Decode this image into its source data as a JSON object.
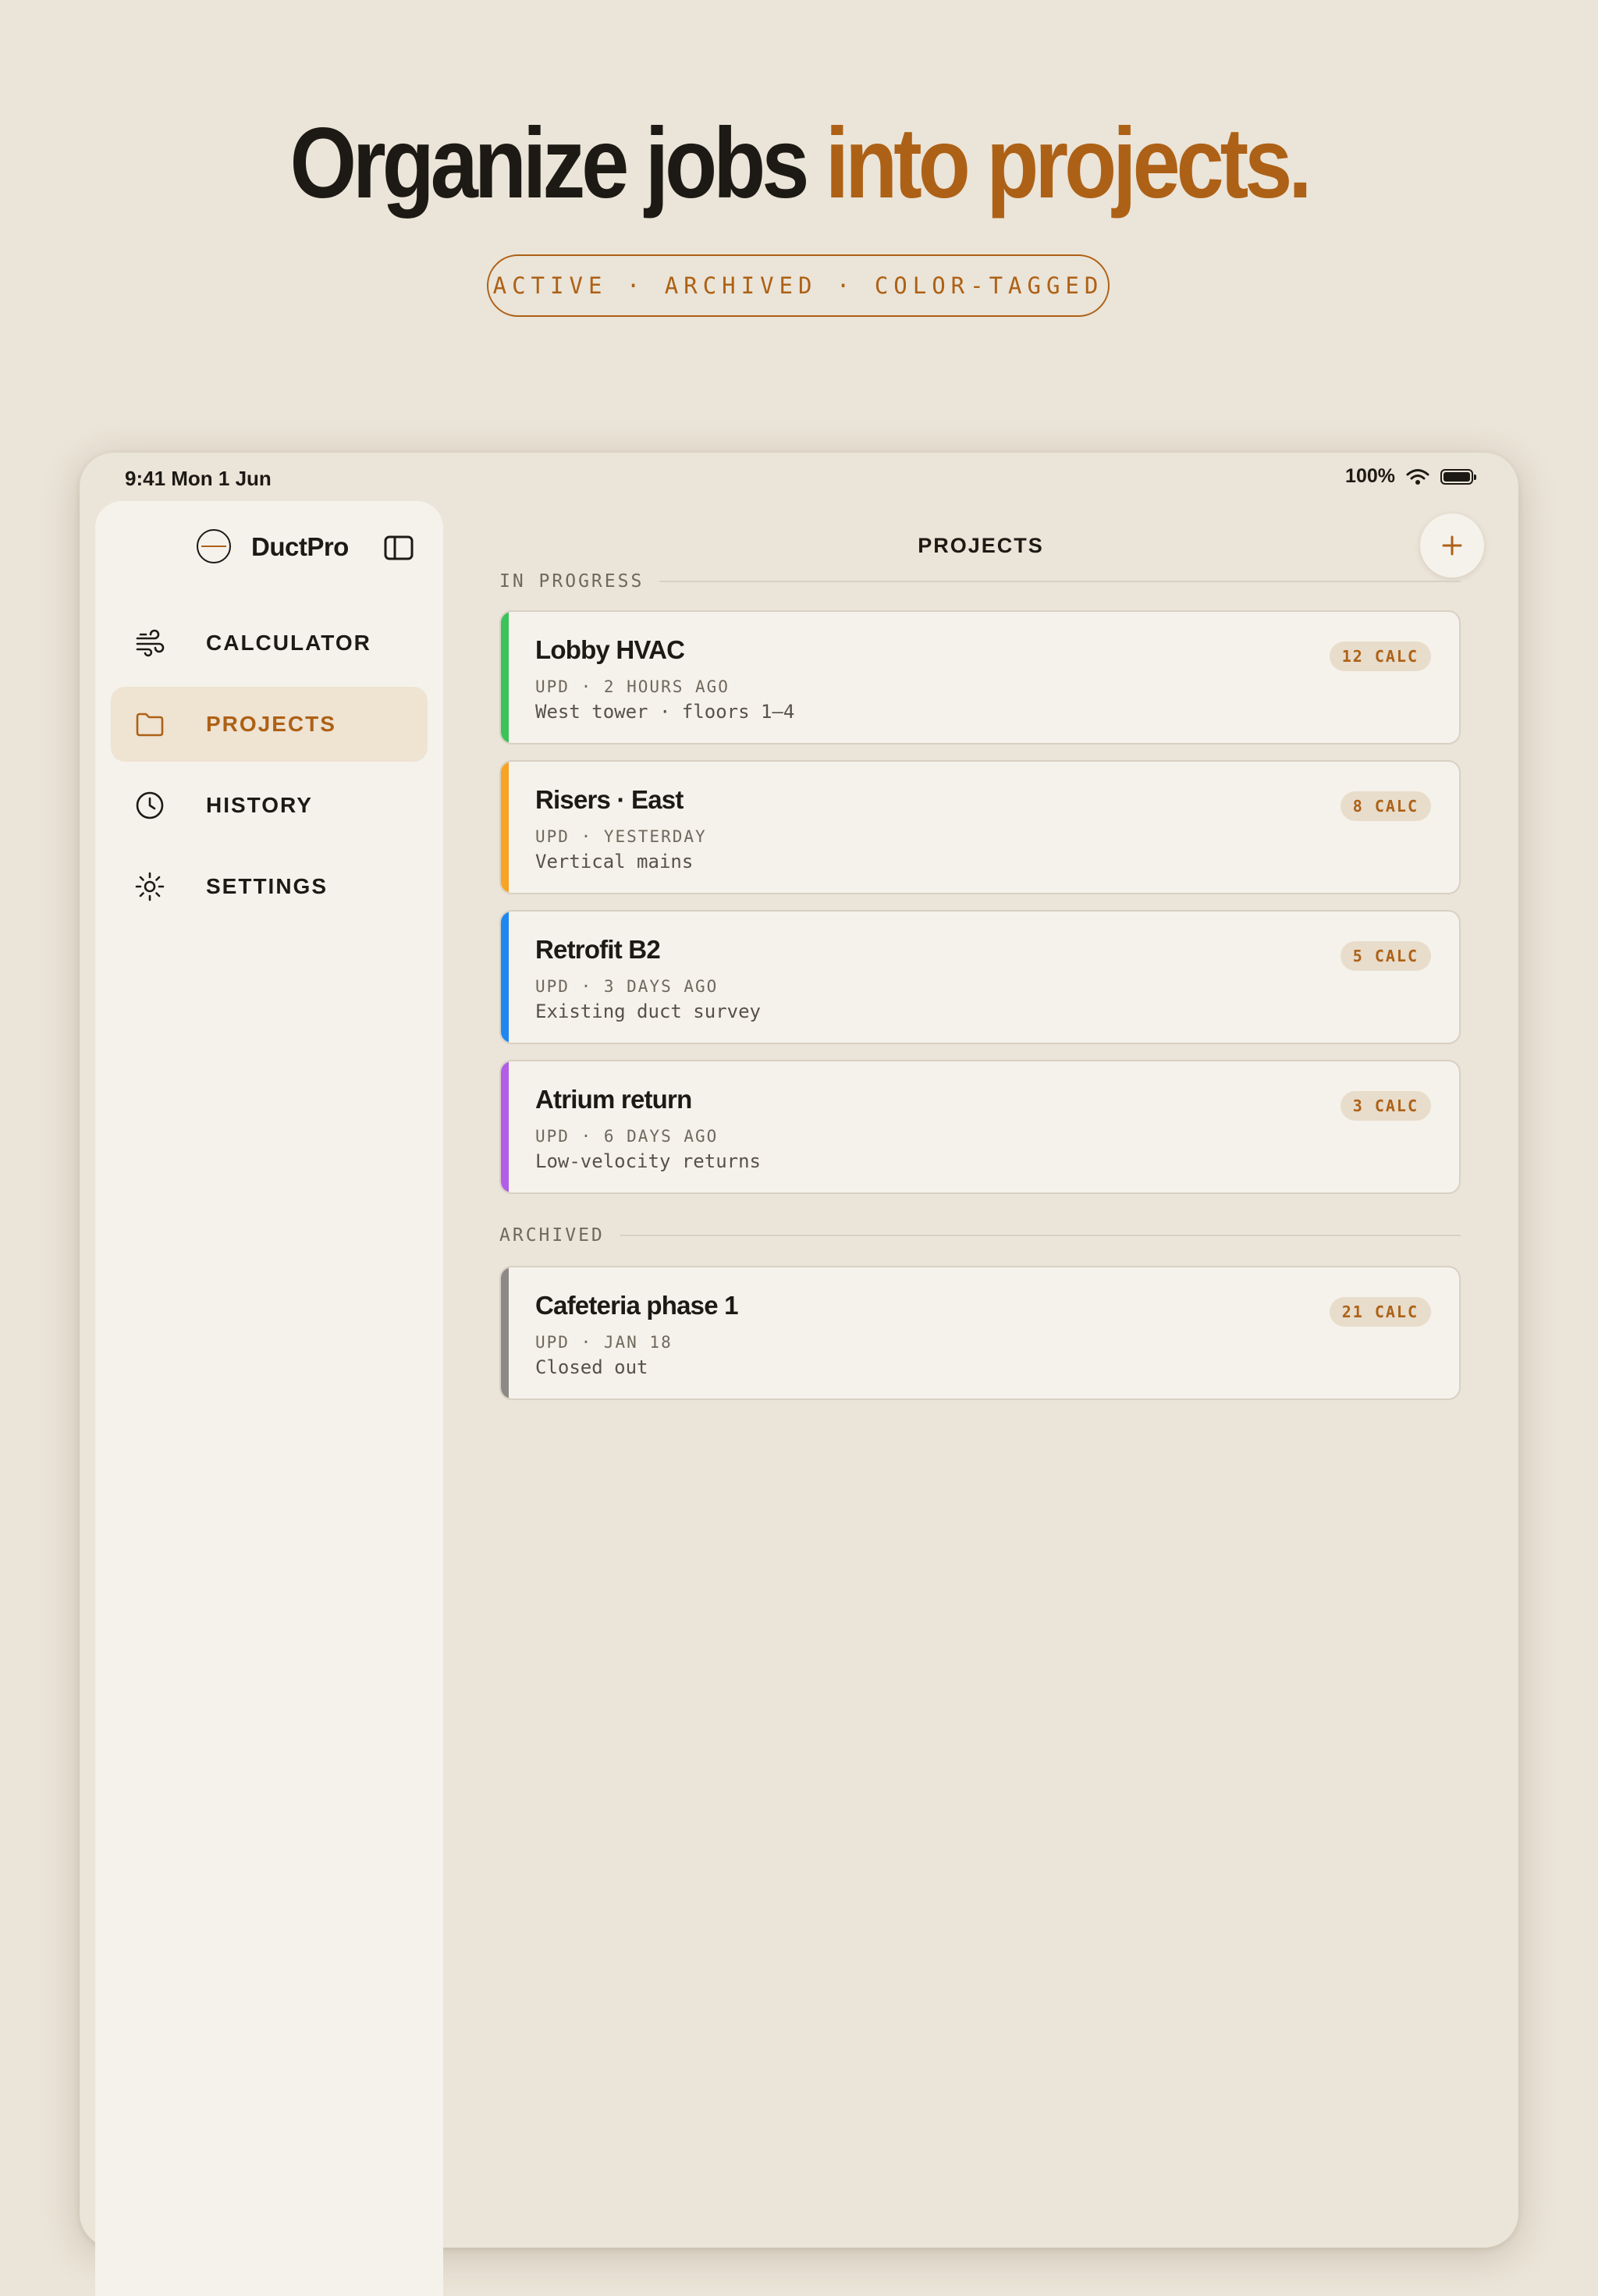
{
  "hero": {
    "title_dark": "Organize jobs",
    "title_accent": "into projects.",
    "tagline": "ACTIVE · ARCHIVED · COLOR-TAGGED"
  },
  "status_bar": {
    "time": "9:41 Mon 1 Jun",
    "battery": "100%",
    "battery_level": 1.0
  },
  "sidebar": {
    "app_name": "DuctPro",
    "items": [
      {
        "label": "CALCULATOR",
        "icon": "wind-icon",
        "active": false
      },
      {
        "label": "PROJECTS",
        "icon": "folder-icon",
        "active": true
      },
      {
        "label": "HISTORY",
        "icon": "clock-icon",
        "active": false
      },
      {
        "label": "SETTINGS",
        "icon": "gear-icon",
        "active": false
      }
    ]
  },
  "main": {
    "title": "PROJECTS",
    "add_icon": "plus-icon",
    "sections": [
      {
        "title": "IN PROGRESS",
        "projects": [
          {
            "name": "Lobby HVAC",
            "updated": "UPD · 2 HOURS AGO",
            "description": "West tower · floors 1–4",
            "badge": "12 CALC",
            "color": "#3cc25a"
          },
          {
            "name": "Risers · East",
            "updated": "UPD · YESTERDAY",
            "description": "Vertical mains",
            "badge": "8 CALC",
            "color": "#f7a325"
          },
          {
            "name": "Retrofit B2",
            "updated": "UPD · 3 DAYS AGO",
            "description": "Existing duct survey",
            "badge": "5 CALC",
            "color": "#1e87f0"
          },
          {
            "name": "Atrium return",
            "updated": "UPD · 6 DAYS AGO",
            "description": "Low-velocity returns",
            "badge": "3 CALC",
            "color": "#b05ee6"
          }
        ]
      },
      {
        "title": "ARCHIVED",
        "projects": [
          {
            "name": "Cafeteria phase 1",
            "updated": "UPD · JAN 18",
            "description": "Closed out",
            "badge": "21 CALC",
            "color": "#8d8a86"
          }
        ]
      }
    ]
  },
  "colors": {
    "background": "#ebe4d8",
    "accent": "#ad6116",
    "surface": "#f5f2eb",
    "text": "#1d1a15"
  }
}
